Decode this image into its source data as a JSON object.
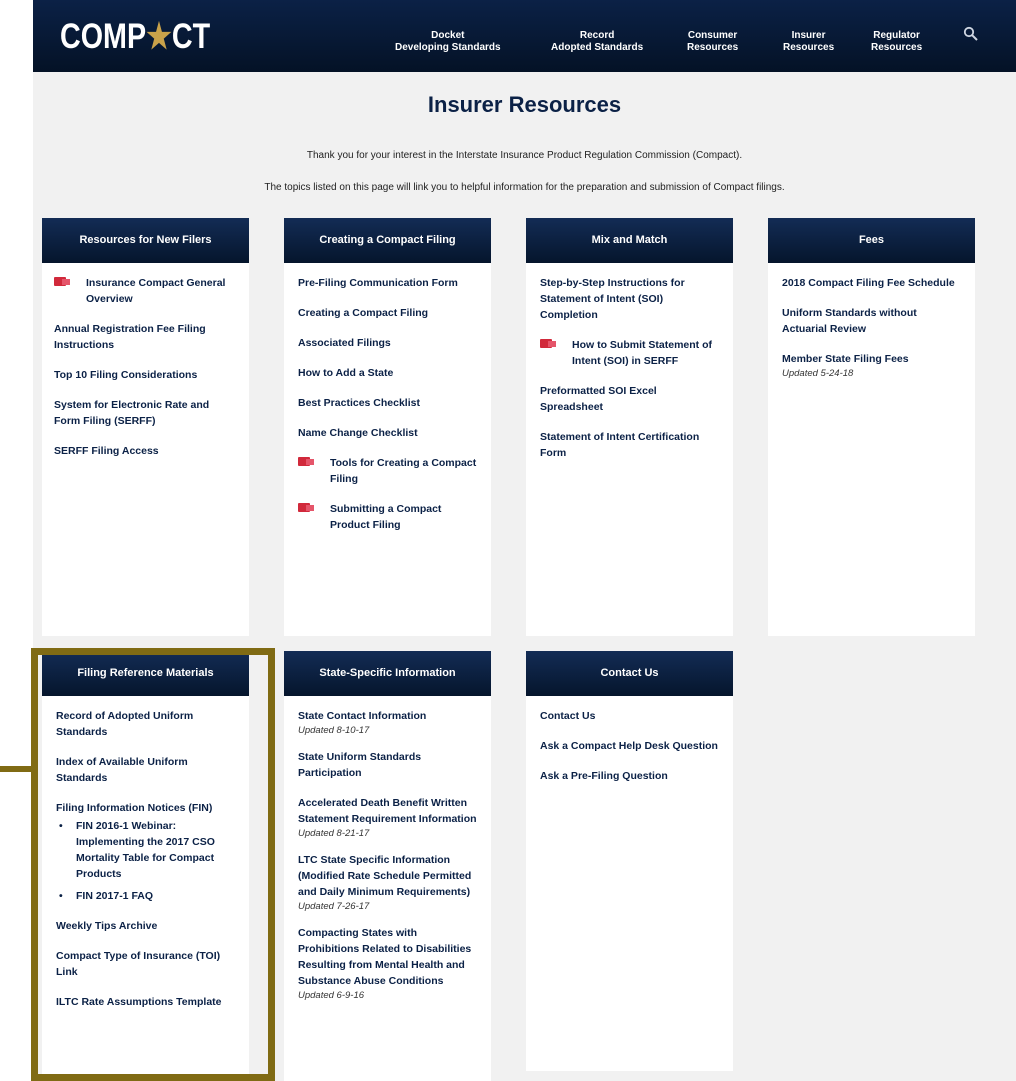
{
  "header": {
    "logo": {
      "left": "COMP",
      "star": "★",
      "right": "CT"
    },
    "nav": [
      {
        "line1": "Docket",
        "line2": "Developing Standards"
      },
      {
        "line1": "Record",
        "line2": "Adopted Standards"
      },
      {
        "line1": "Consumer",
        "line2": "Resources"
      },
      {
        "line1": "Insurer",
        "line2": "Resources"
      },
      {
        "line1": "Regulator",
        "line2": "Resources"
      }
    ],
    "search_icon": "search-icon"
  },
  "page": {
    "title": "Insurer Resources",
    "intro1": "Thank you for your interest in the Interstate Insurance Product Regulation Commission (Compact).",
    "intro2": "The topics listed on this page will link you to helpful information for the preparation and submission of Compact filings."
  },
  "cards": {
    "new_filers": {
      "title": "Resources for New Filers",
      "items": [
        {
          "label": "Insurance Compact General Overview"
        },
        {
          "label": "Annual Registration Fee Filing Instructions"
        },
        {
          "label": "Top 10 Filing Considerations"
        },
        {
          "label": "System for Electronic Rate and Form Filing (SERFF)"
        },
        {
          "label": "SERFF Filing Access"
        }
      ]
    },
    "creating": {
      "title": "Creating a Compact Filing",
      "items": [
        {
          "label": "Pre-Filing Communication Form"
        },
        {
          "label": "Creating a Compact Filing"
        },
        {
          "label": "Associated Filings"
        },
        {
          "label": "How to Add a State"
        },
        {
          "label": "Best Practices Checklist"
        },
        {
          "label": "Name Change Checklist"
        },
        {
          "label": "Tools for Creating a Compact Filing"
        },
        {
          "label": "Submitting a Compact Product Filing"
        }
      ]
    },
    "mix": {
      "title": "Mix and Match",
      "items": [
        {
          "label": "Step-by-Step Instructions for Statement of Intent (SOI) Completion"
        },
        {
          "label": "How to Submit Statement of Intent (SOI) in SERFF"
        },
        {
          "label": "Preformatted SOI Excel Spreadsheet"
        },
        {
          "label": "Statement of Intent Certification Form"
        }
      ]
    },
    "fees": {
      "title": "Fees",
      "items": [
        {
          "label": "2018 Compact Filing Fee Schedule"
        },
        {
          "label": "Uniform Standards without Actuarial Review"
        },
        {
          "label": "Member State Filing Fees",
          "updated": "Updated 5-24-18"
        }
      ]
    },
    "reference": {
      "title": "Filing Reference Materials",
      "items": [
        {
          "label": "Record of Adopted Uniform Standards"
        },
        {
          "label": "Index of Available Uniform Standards"
        },
        {
          "label": "Filing Information Notices (FIN)"
        },
        {
          "label": "FIN 2016-1 Webinar: Implementing the 2017 CSO Mortality Table for Compact Products"
        },
        {
          "label": "FIN 2017-1 FAQ"
        },
        {
          "label": "Weekly Tips Archive"
        },
        {
          "label": "Compact Type of Insurance (TOI) Link"
        },
        {
          "label": "ILTC Rate Assumptions Template"
        }
      ]
    },
    "state": {
      "title": "State-Specific Information",
      "items": [
        {
          "label": "State Contact Information",
          "updated": "Updated 8-10-17"
        },
        {
          "label": "State Uniform Standards Participation"
        },
        {
          "label": "Accelerated Death Benefit Written Statement Requirement Information",
          "updated": "Updated 8-21-17"
        },
        {
          "label": "LTC State Specific Information (Modified Rate Schedule Permitted and Daily Minimum Requirements)",
          "updated": "Updated 7-26-17"
        },
        {
          "label": "Compacting States with Prohibitions Related to Disabilities Resulting from Mental Health and Substance Abuse Conditions",
          "updated": "Updated 6-9-16"
        }
      ]
    },
    "contact": {
      "title": "Contact Us",
      "items": [
        {
          "label": "Contact Us"
        },
        {
          "label": "Ask a Compact Help Desk Question"
        },
        {
          "label": "Ask a Pre-Filing Question"
        }
      ]
    }
  },
  "colors": {
    "navy": "#0b2146",
    "gold_highlight": "#806b14",
    "pdf_red": "#d1293b",
    "page_bg": "#f1f1f1"
  }
}
